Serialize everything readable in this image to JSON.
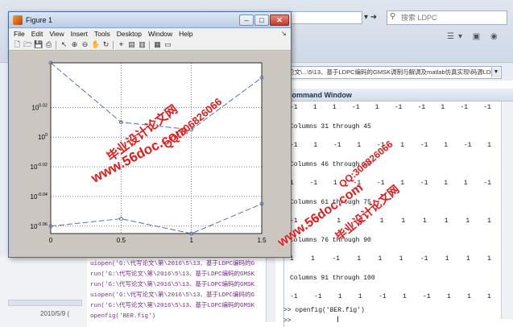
{
  "desktop": {
    "search_placeholder": "搜索 LDPC",
    "path_text": "论文\\...\\5\\13、基于LDPC编码的GMSK调制与解调及matlab仿真实现\\码源LDPC",
    "command_window_title": "Command Window",
    "command_lines": [
      {
        "type": "nums",
        "values": [
          "-1",
          "1",
          "1",
          "-1",
          "1",
          "-1",
          "-1",
          "1",
          "-1",
          "-1"
        ]
      },
      {
        "type": "text",
        "text": "Columns 31 through 45"
      },
      {
        "type": "nums",
        "values": [
          "-1",
          "1",
          "-1",
          "1",
          "-1",
          "1",
          "-1",
          "1",
          "-1",
          "1"
        ]
      },
      {
        "type": "text",
        "text": "Columns 46 through 60"
      },
      {
        "type": "nums",
        "values": [
          "1",
          "-1",
          "1",
          "-1",
          "-1",
          "1",
          "-1",
          "1",
          "1",
          "-1"
        ]
      },
      {
        "type": "text",
        "text": "Columns 61 through 75"
      },
      {
        "type": "nums",
        "values": [
          "-1",
          "1",
          "1",
          "1",
          "1",
          "1",
          "1",
          "1",
          "1",
          "1"
        ]
      },
      {
        "type": "text",
        "text": "Columns 76 through 90"
      },
      {
        "type": "nums",
        "values": [
          "1",
          "1",
          "-1",
          "1",
          "1",
          "1",
          "-1",
          "1",
          "1",
          "1"
        ]
      },
      {
        "type": "text",
        "text": "Columns 91 through 100"
      },
      {
        "type": "nums",
        "values": [
          "-1",
          "-1",
          "1",
          "1",
          "-1",
          "1",
          "-1",
          "1",
          "1",
          "1"
        ]
      }
    ],
    "prompt_command": ">> openfig('BER.fig')",
    "prompt_empty": ">>",
    "history": [
      "uiopen('G:\\代写论文\\第\\2016\\5\\13、基于LDPC编码的G",
      "run('G:\\代写论文\\第\\2016\\5\\13、基于LDPC编码的GMSK",
      "run('G:\\代写论文\\第\\2016\\5\\13、基于LDPC编码的GMSK",
      "uiopen('G:\\代写论文\\第\\2016\\5\\13、基于LDPC编码的G",
      "run('G:\\代写论文\\第\\2016\\5\\13、基于LDPC编码的GMSK",
      "openfig('BER.fig')"
    ],
    "date_text": "2010/5/9 ("
  },
  "figure": {
    "title": "Figure 1",
    "menus": [
      "File",
      "Edit",
      "View",
      "Insert",
      "Tools",
      "Desktop",
      "Window",
      "Help"
    ]
  },
  "chart_data": {
    "type": "line",
    "x": [
      0,
      0.5,
      1,
      1.5
    ],
    "series": [
      {
        "values_log10": [
          0.05,
          0.01,
          0.005,
          0.04
        ],
        "color": "#5a6fb0",
        "style": "dashed"
      },
      {
        "values_log10": [
          -0.06,
          -0.055,
          -0.065,
          -0.045
        ],
        "color": "#5a6fb0",
        "style": "dashed"
      }
    ],
    "xlim": [
      0,
      1.5
    ],
    "ylim_log10": [
      -0.065,
      0.05
    ],
    "xticks": [
      "0",
      "0.5",
      "1",
      "1.5"
    ],
    "yticks": [
      {
        "base": "10",
        "exp": "0.02",
        "v": 0.02
      },
      {
        "base": "10",
        "exp": "0",
        "v": 0
      },
      {
        "base": "10",
        "exp": "-0.02",
        "v": -0.02
      },
      {
        "base": "10",
        "exp": "-0.04",
        "v": -0.04
      },
      {
        "base": "10",
        "exp": "-0.06",
        "v": -0.06
      }
    ],
    "grid": true,
    "yscale": "log"
  },
  "watermarks": {
    "site": "www.56doc.com",
    "brand": "毕业设计论文网",
    "qq": "QQ:306826066"
  },
  "colors": {
    "watermark": "#e31b1b",
    "line": "#5a6fb0",
    "history_text": "#7a2a8a"
  }
}
